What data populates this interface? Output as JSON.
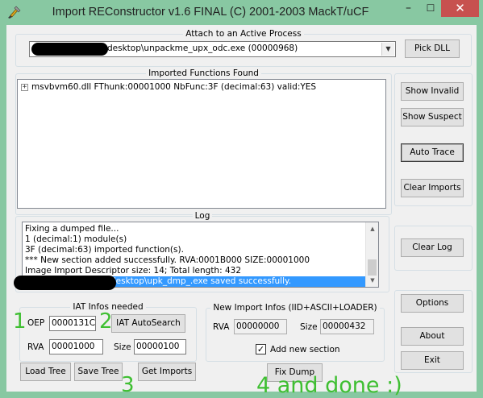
{
  "window": {
    "title": "Import REConstructor v1.6 FINAL (C) 2001-2003 MackT/uCF",
    "minimize_glyph": "–",
    "maximize_glyph": "☐",
    "close_glyph": "✕"
  },
  "attach": {
    "group_label": "Attach to an Active Process",
    "process_text": "desktop\\unpackme_upx_odc.exe (00000968)",
    "pick_dll_label": "Pick DLL"
  },
  "imported": {
    "group_label": "Imported Functions Found",
    "tree_toggle": "+",
    "tree_item": "msvbvm60.dll FThunk:00001000 NbFunc:3F (decimal:63) valid:YES"
  },
  "right_buttons": {
    "show_invalid": "Show Invalid",
    "show_suspect": "Show Suspect",
    "auto_trace": "Auto Trace",
    "clear_imports": "Clear Imports",
    "clear_log": "Clear Log",
    "options": "Options",
    "about": "About",
    "exit": "Exit"
  },
  "log": {
    "group_label": "Log",
    "lines": [
      "Fixing a dumped file...",
      "1 (decimal:1) module(s)",
      "3F (decimal:63) imported function(s).",
      "*** New section added successfully. RVA:0001B000 SIZE:00001000",
      "Image Import Descriptor size: 14; Total length: 432"
    ],
    "selected_line": "desktop\\upk_dmp_.exe saved successfully."
  },
  "iat": {
    "group_label": "IAT Infos needed",
    "oep_label": "OEP",
    "oep_value": "0000131C",
    "autosearch_label": "IAT AutoSearch",
    "rva_label": "RVA",
    "rva_value": "00001000",
    "size_label": "Size",
    "size_value": "00000100"
  },
  "newimport": {
    "group_label": "New Import Infos (IID+ASCII+LOADER)",
    "rva_label": "RVA",
    "rva_value": "00000000",
    "size_label": "Size",
    "size_value": "00000432",
    "add_section_label": "Add new section",
    "add_section_checked": true,
    "check_glyph": "✓"
  },
  "bottom_buttons": {
    "load_tree": "Load Tree",
    "save_tree": "Save Tree",
    "get_imports": "Get Imports",
    "fix_dump": "Fix Dump"
  },
  "annotations": {
    "step1": "1",
    "step2": "2",
    "step3": "3",
    "step4": "4 and done :)",
    "color": "#3fbf32"
  },
  "colors": {
    "titlebar": "#88c8a2",
    "close_button": "#c7514f",
    "selection": "#3399ff"
  },
  "icons": {
    "app": "app-icon",
    "combo_arrow": "▼",
    "scroll_up": "▲",
    "scroll_down": "▼"
  }
}
